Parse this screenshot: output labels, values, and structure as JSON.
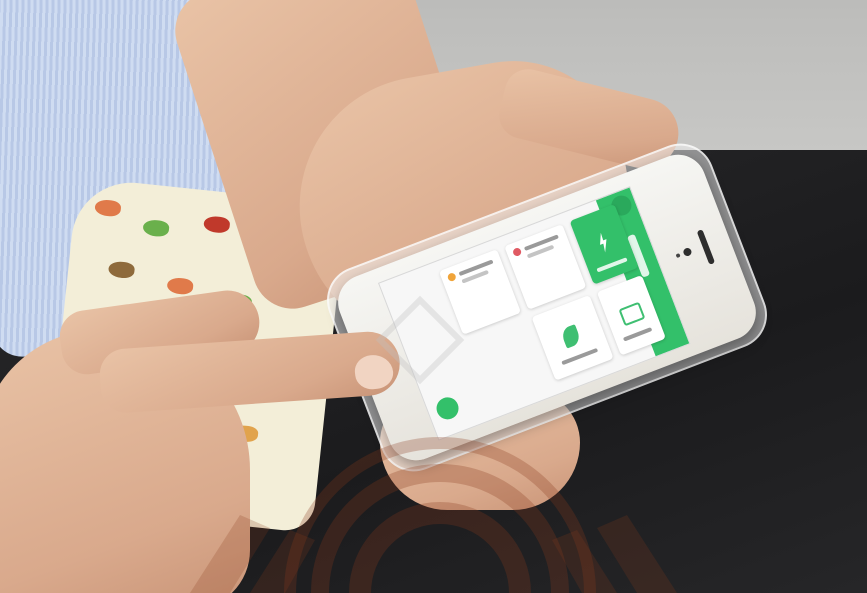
{
  "scene": {
    "description_visible": false
  },
  "app": {
    "accent_color": "#33c06a",
    "header_title": "",
    "cards": [
      {
        "id": "card-a",
        "title": "",
        "icon": "red-dot-icon",
        "color": "#e05a63"
      },
      {
        "id": "card-b",
        "title": "",
        "icon": "orange-dot-icon",
        "color": "#f0a43a"
      },
      {
        "id": "card-big",
        "title": "",
        "icon": "lightning-icon"
      },
      {
        "id": "card-c",
        "title": "",
        "icon": "leaf-icon"
      },
      {
        "id": "card-d",
        "title": "",
        "icon": "dish-icon"
      }
    ],
    "fab_icon": "add-icon"
  },
  "watermark": {
    "icon": "university-seal-icon",
    "color": "#8a3b1b"
  }
}
